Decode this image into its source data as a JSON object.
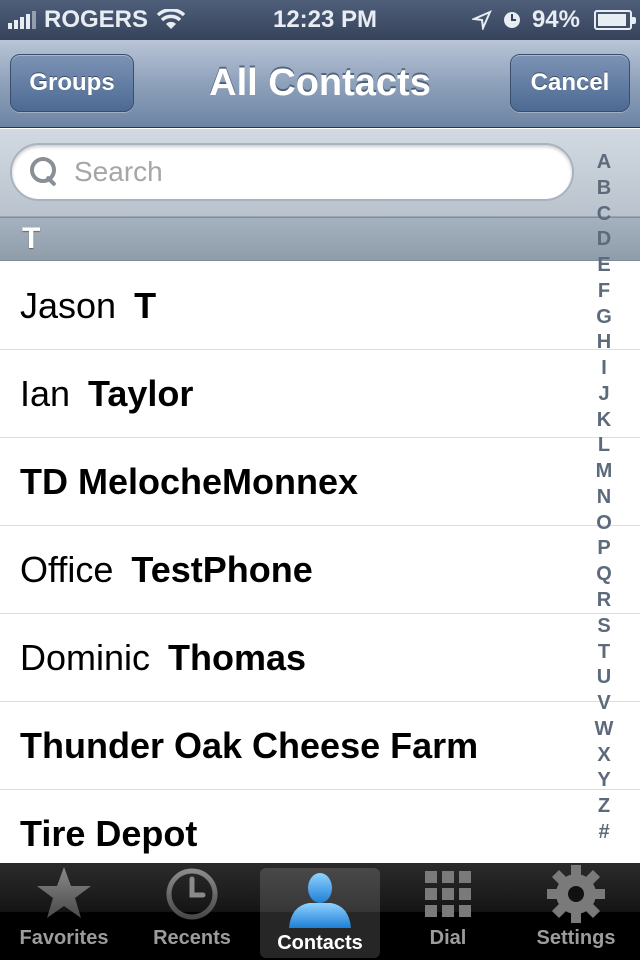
{
  "status_bar": {
    "carrier": "ROGERS",
    "time": "12:23 PM",
    "battery": "94%",
    "battery_level": 0.94
  },
  "nav": {
    "title": "All Contacts",
    "left_button": "Groups",
    "right_button": "Cancel"
  },
  "search": {
    "placeholder": "Search"
  },
  "section": {
    "letter": "T"
  },
  "contacts": [
    {
      "first": "Jason",
      "last": "T"
    },
    {
      "first": "Ian",
      "last": "Taylor"
    },
    {
      "first": "",
      "last": "TD MelocheMonnex"
    },
    {
      "first": "Office",
      "last": "TestPhone"
    },
    {
      "first": "Dominic",
      "last": "Thomas"
    },
    {
      "first": "",
      "last": "Thunder Oak Cheese Farm"
    },
    {
      "first": "",
      "last": "Tire Depot"
    }
  ],
  "index": [
    "A",
    "B",
    "C",
    "D",
    "E",
    "F",
    "G",
    "H",
    "I",
    "J",
    "K",
    "L",
    "M",
    "N",
    "O",
    "P",
    "Q",
    "R",
    "S",
    "T",
    "U",
    "V",
    "W",
    "X",
    "Y",
    "Z",
    "#"
  ],
  "tabs": [
    {
      "label": "Favorites",
      "icon": "star-icon"
    },
    {
      "label": "Recents",
      "icon": "clock-icon"
    },
    {
      "label": "Contacts",
      "icon": "person-icon",
      "active": true
    },
    {
      "label": "Dial",
      "icon": "keypad-icon"
    },
    {
      "label": "Settings",
      "icon": "gear-icon"
    }
  ],
  "colors": {
    "active_tab_icon": "#3fa0e8",
    "nav_blue": "#6d84a3"
  }
}
